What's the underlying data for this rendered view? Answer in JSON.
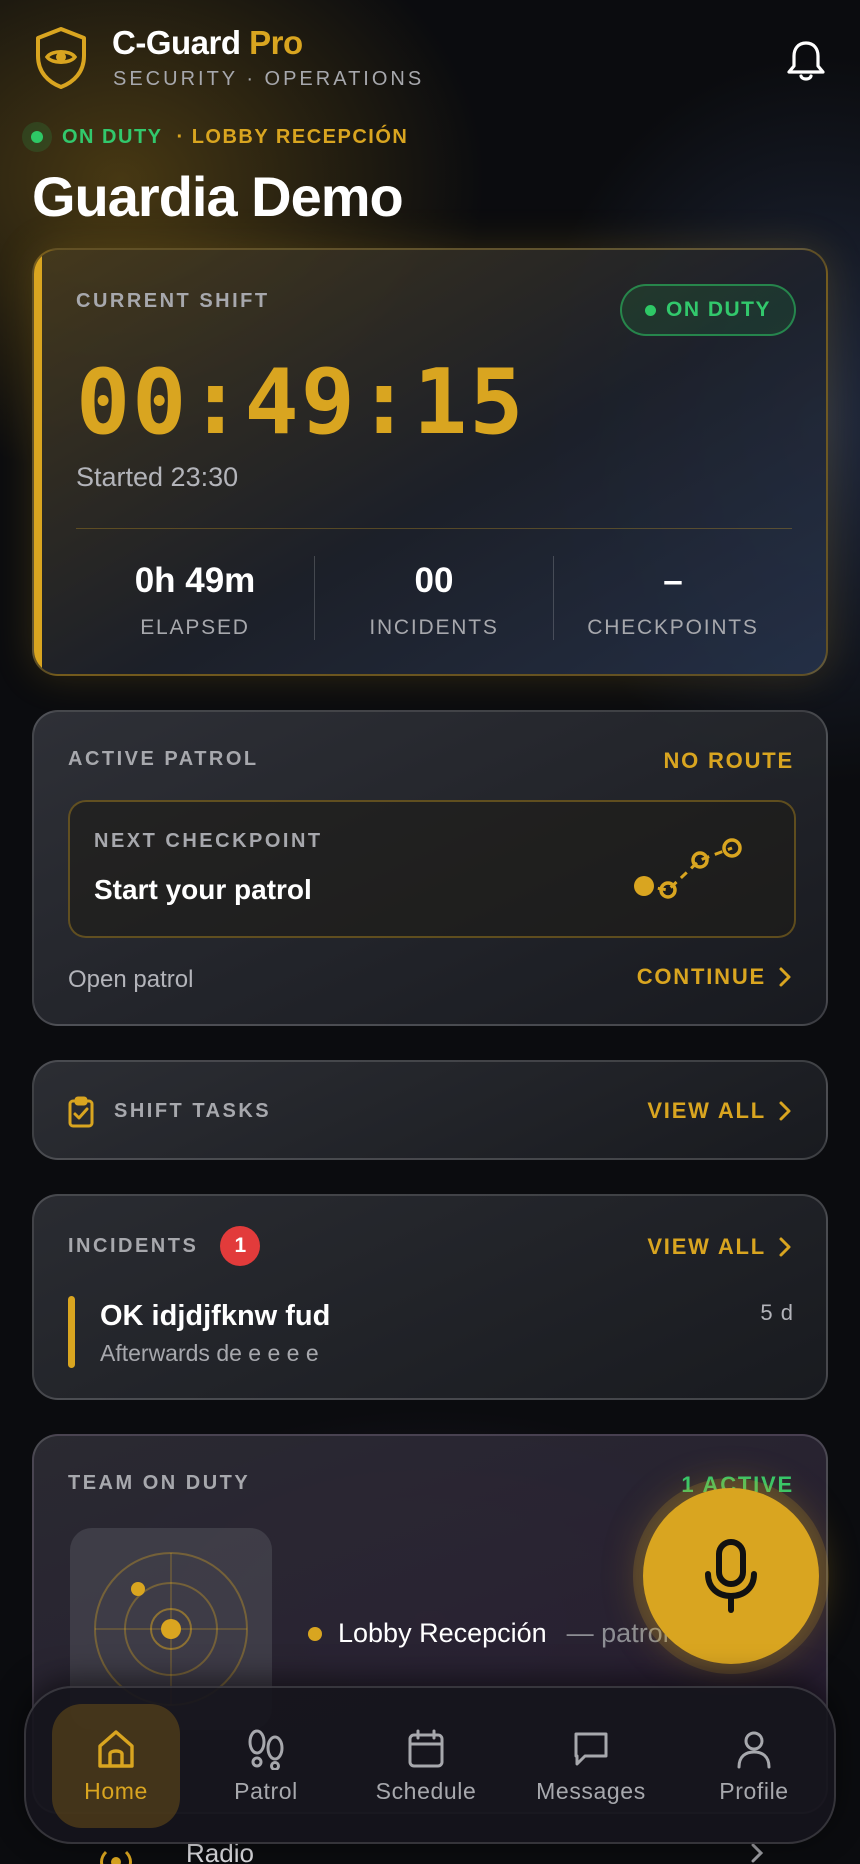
{
  "app": {
    "brand_main": "C-Guard",
    "brand_pro": "Pro",
    "subtitle": "SECURITY · OPERATIONS"
  },
  "status": {
    "duty": "ON DUTY",
    "location": "· LOBBY RECEPCIÓN"
  },
  "guard_name": "Guardia Demo",
  "shift": {
    "label": "CURRENT SHIFT",
    "badge": "ON DUTY",
    "timer": "00:49:15",
    "started": "Started 23:30",
    "stats": [
      {
        "value": "0h 49m",
        "label": "ELAPSED"
      },
      {
        "value": "00",
        "label": "INCIDENTS"
      },
      {
        "value": "–",
        "label": "CHECKPOINTS"
      }
    ]
  },
  "patrol": {
    "label": "ACTIVE PATROL",
    "route_status": "NO ROUTE",
    "next_label": "NEXT CHECKPOINT",
    "next_value": "Start your patrol",
    "open_link": "Open patrol",
    "continue": "CONTINUE"
  },
  "tasks": {
    "label": "SHIFT TASKS",
    "view_all": "VIEW ALL"
  },
  "incidents": {
    "label": "INCIDENTS",
    "count": "1",
    "view_all": "VIEW ALL",
    "items": [
      {
        "title": "OK idjdjfknw fud",
        "subtitle": "Afterwards de e e e e",
        "age": "5 d"
      }
    ]
  },
  "team": {
    "label": "TEAM ON DUTY",
    "active": "1 ACTIVE",
    "member_location": "Lobby Recepción",
    "member_status": "— patrol"
  },
  "peek_item": "Radio",
  "nav": [
    {
      "label": "Home",
      "icon": "home-icon"
    },
    {
      "label": "Patrol",
      "icon": "footsteps-icon"
    },
    {
      "label": "Schedule",
      "icon": "calendar-icon"
    },
    {
      "label": "Messages",
      "icon": "message-icon"
    },
    {
      "label": "Profile",
      "icon": "person-icon"
    }
  ],
  "colors": {
    "accent": "#d9a520",
    "success": "#32c86c",
    "danger": "#e23b3b",
    "background": "#0b0c0f"
  }
}
